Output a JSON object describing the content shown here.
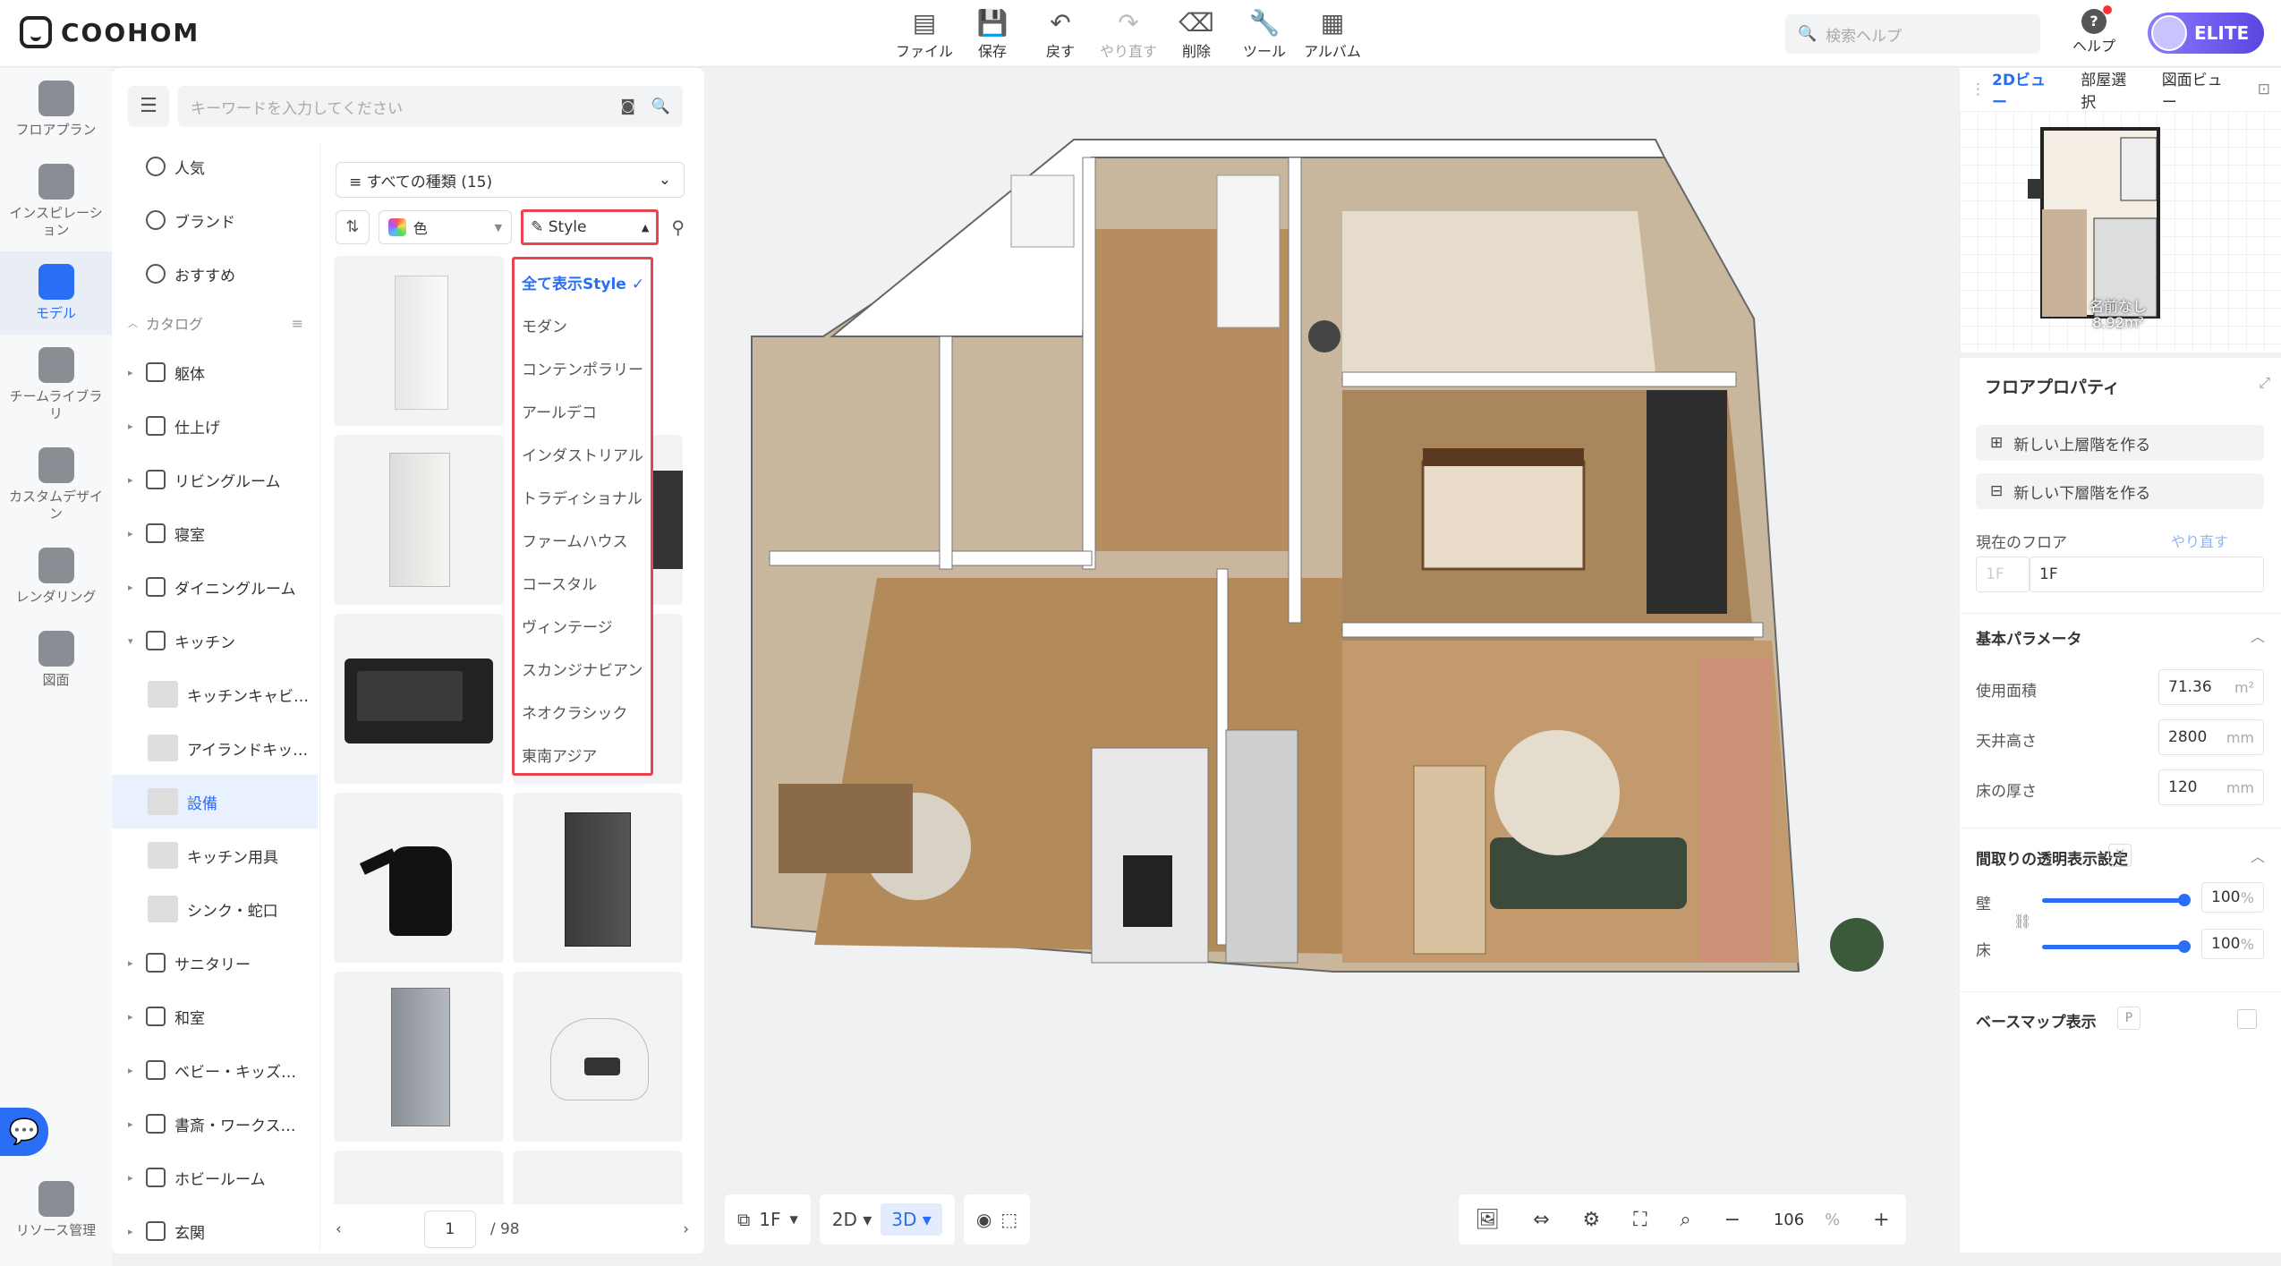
{
  "app": {
    "logo_text": "COOHOM"
  },
  "toolbar": [
    {
      "label": "ファイル",
      "icon": "file-icon",
      "glyph": "▤",
      "disabled": false
    },
    {
      "label": "保存",
      "icon": "save-icon",
      "glyph": "💾",
      "disabled": false
    },
    {
      "label": "戻す",
      "icon": "undo-icon",
      "glyph": "↶",
      "disabled": false
    },
    {
      "label": "やり直す",
      "icon": "redo-icon",
      "glyph": "↷",
      "disabled": true
    },
    {
      "label": "削除",
      "icon": "eraser-icon",
      "glyph": "⌫",
      "disabled": false
    },
    {
      "label": "ツール",
      "icon": "wrench-icon",
      "glyph": "🔧",
      "disabled": false
    },
    {
      "label": "アルバム",
      "icon": "album-icon",
      "glyph": "▦",
      "disabled": false
    }
  ],
  "help_search": {
    "placeholder": "検索ヘルプ"
  },
  "help": {
    "label": "ヘルプ"
  },
  "account": {
    "badge": "ELITE"
  },
  "leftnav": [
    {
      "label": "フロアプラン",
      "active": false
    },
    {
      "label": "インスピレーション",
      "active": false
    },
    {
      "label": "モデル",
      "active": true
    },
    {
      "label": "チームライブラリ",
      "active": false
    },
    {
      "label": "カスタムデザイン",
      "active": false
    },
    {
      "label": "レンダリング",
      "active": false
    },
    {
      "label": "図面",
      "active": false
    }
  ],
  "leftnav_bottom": {
    "label": "リソース管理"
  },
  "catalog": {
    "search_placeholder": "キーワードを入力してください",
    "quick": [
      "人気",
      "ブランド",
      "おすすめ"
    ],
    "section_label": "カタログ",
    "tree": [
      {
        "label": "躯体",
        "type": "caret"
      },
      {
        "label": "仕上げ",
        "type": "caret"
      },
      {
        "label": "リビングルーム",
        "type": "caret"
      },
      {
        "label": "寝室",
        "type": "caret"
      },
      {
        "label": "ダイニングルーム",
        "type": "caret"
      },
      {
        "label": "キッチン",
        "type": "open"
      },
      {
        "label": "キッチンキャビ…",
        "type": "sub"
      },
      {
        "label": "アイランドキッ…",
        "type": "sub"
      },
      {
        "label": "設備",
        "type": "sub",
        "active": true
      },
      {
        "label": "キッチン用具",
        "type": "sub"
      },
      {
        "label": "シンク・蛇口",
        "type": "sub"
      },
      {
        "label": "サニタリー",
        "type": "caret"
      },
      {
        "label": "和室",
        "type": "caret"
      },
      {
        "label": "ベビー・キッズ…",
        "type": "caret"
      },
      {
        "label": "書斎・ワークス…",
        "type": "caret"
      },
      {
        "label": "ホビールーム",
        "type": "caret"
      },
      {
        "label": "玄関",
        "type": "caret"
      }
    ],
    "filter_all": "すべての種類 (15)",
    "color_label": "色",
    "style_label": "Style",
    "style_options": [
      "全て表示Style",
      "モダン",
      "コンテンポラリー",
      "アールデコ",
      "インダストリアル",
      "トラディショナル",
      "ファームハウス",
      "コースタル",
      "ヴィンテージ",
      "スカンジナビアン",
      "ネオクラシック",
      "東南アジア"
    ],
    "style_selected": "全て表示Style",
    "pager": {
      "current": "1",
      "total": "/ 98"
    }
  },
  "canvas_controls": {
    "floor": "1F",
    "view_2d": "2D",
    "view_3d": "3D",
    "zoom": "106",
    "zoom_unit": "%"
  },
  "right": {
    "tabs": [
      "2Dビュー",
      "部屋選択",
      "図面ビュー"
    ],
    "minimap_room": {
      "name": "名前なし",
      "area": "8.92m²"
    },
    "title": "フロアプロパティ",
    "btn_up": "新しい上層階を作る",
    "btn_down": "新しい下層階を作る",
    "current_floor_label": "現在のフロア",
    "redo_link": "やり直す",
    "floor_prefix": "1F",
    "floor_value": "1F",
    "basic_params": "基本パラメータ",
    "area_label": "使用面積",
    "area_value": "71.36",
    "area_unit": "m²",
    "ceiling_label": "天井高さ",
    "ceiling_value": "2800",
    "ceiling_unit": "mm",
    "floor_thick_label": "床の厚さ",
    "floor_thick_value": "120",
    "floor_thick_unit": "mm",
    "transparency_label": "間取りの透明表示設定",
    "transparency_key": "Y",
    "wall_label": "壁",
    "wall_value": "100",
    "floor_label": "床",
    "floor_opacity_value": "100",
    "pct": "%",
    "basemap_label": "ベースマップ表示",
    "basemap_key": "P"
  }
}
